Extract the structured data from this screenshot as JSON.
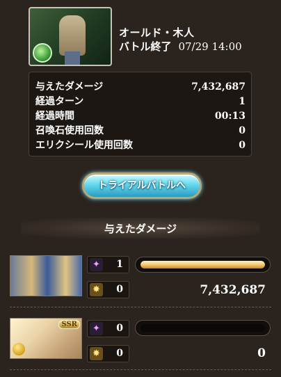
{
  "boss": {
    "name": "オールド・木人",
    "status": "バトル終了",
    "datetime": "07/29 14:00",
    "image_icon": "training-dummy-icon",
    "element_icon": "wind-element-icon"
  },
  "stats": [
    {
      "label": "与えたダメージ",
      "value": "7,432,687"
    },
    {
      "label": "経過ターン",
      "value": "1"
    },
    {
      "label": "経過時間",
      "value": "00:13"
    },
    {
      "label": "召喚石使用回数",
      "value": "0"
    },
    {
      "label": "エリクシール使用回数",
      "value": "0"
    }
  ],
  "trial_button": {
    "label": "トライアルバトルへ"
  },
  "section": {
    "title": "与えたダメージ"
  },
  "characters": [
    {
      "summon_count": "1",
      "chain_count": "0",
      "damage": "7,432,687",
      "damage_share": 1.0,
      "badge": ""
    },
    {
      "summon_count": "0",
      "chain_count": "0",
      "damage": "0",
      "damage_share": 0.0,
      "badge": "SSR"
    }
  ],
  "colors": {
    "background": "#2b241e",
    "bar_fill": "#f2c46a",
    "button": "#64d8ee"
  }
}
